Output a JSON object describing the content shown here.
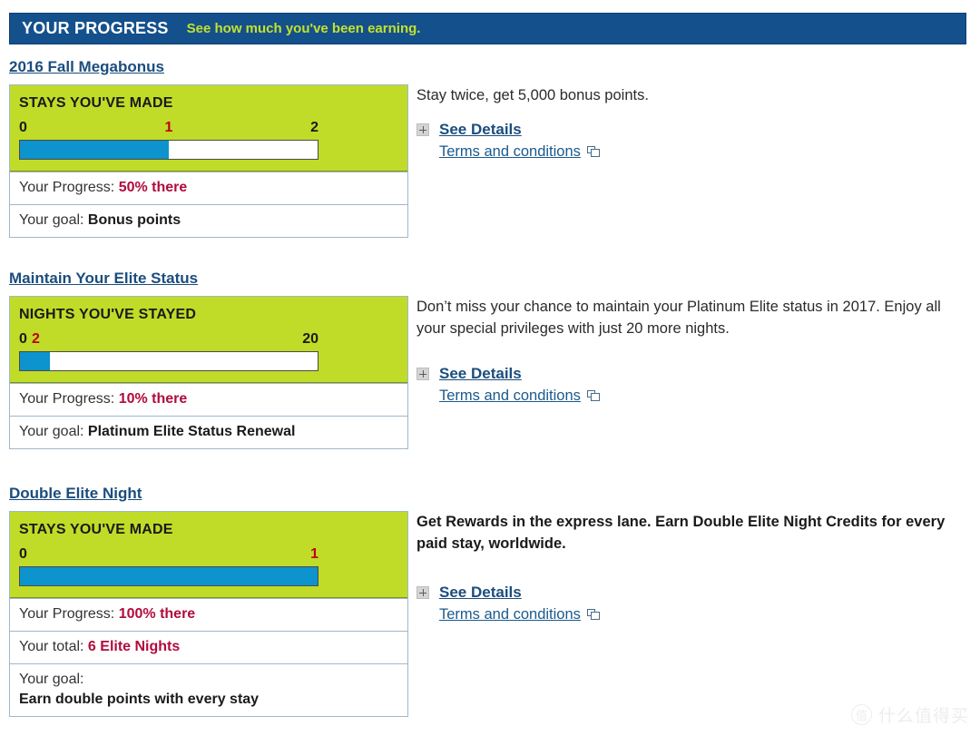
{
  "header": {
    "title": "YOUR PROGRESS",
    "subtitle": "See how much you've been earning.",
    "bg_color": "#14508c",
    "subtitle_color": "#c2e22d"
  },
  "colors": {
    "card_green": "#c0dc28",
    "bar_blue": "#0d93cd",
    "link_blue": "#1b4d7e",
    "value_red": "#b10b3d",
    "marker_red": "#c00010"
  },
  "sections": [
    {
      "link_label": "2016 Fall Megabonus",
      "card": {
        "heading": "STAYS YOU'VE MADE",
        "scale_min": "0",
        "scale_current": "1",
        "scale_max": "2",
        "percent": 50,
        "rows": [
          {
            "label": "Your Progress:",
            "value": "50% there",
            "style": "red",
            "stacked": false
          },
          {
            "label": "Your goal:",
            "value": "Bonus points",
            "style": "dark",
            "stacked": false
          }
        ]
      },
      "description": "Stay twice, get 5,000 bonus points.",
      "description_bold": false,
      "see_details_label": "See Details",
      "terms_label": "Terms and conditions"
    },
    {
      "link_label": "Maintain Your Elite Status",
      "card": {
        "heading": "NIGHTS YOU'VE STAYED",
        "scale_min": "0",
        "scale_current": "2",
        "scale_max": "20",
        "percent": 10,
        "rows": [
          {
            "label": "Your Progress:",
            "value": "10% there",
            "style": "red",
            "stacked": false
          },
          {
            "label": "Your goal:",
            "value": "Platinum Elite Status Renewal",
            "style": "dark",
            "stacked": false
          }
        ]
      },
      "description": "Don’t miss your chance to maintain your Platinum Elite status in 2017. Enjoy all your special privileges with just 20 more nights.",
      "description_bold": false,
      "see_details_label": "See Details",
      "terms_label": "Terms and conditions"
    },
    {
      "link_label": "Double Elite Night",
      "card": {
        "heading": "STAYS YOU'VE MADE",
        "scale_min": "0",
        "scale_current": "1",
        "scale_max": "",
        "percent": 100,
        "rows": [
          {
            "label": "Your Progress:",
            "value": "100% there",
            "style": "red",
            "stacked": false
          },
          {
            "label": "Your total:",
            "value": "6 Elite Nights",
            "style": "red",
            "stacked": false
          },
          {
            "label": "Your goal:",
            "value": "Earn double points with every stay",
            "style": "dark",
            "stacked": true
          }
        ]
      },
      "description": "Get Rewards in the express lane. Earn Double Elite Night Credits for every paid stay, worldwide.",
      "description_bold": true,
      "see_details_label": "See Details",
      "terms_label": "Terms and conditions"
    }
  ],
  "watermark": {
    "mark": "值",
    "text": "什么值得买"
  }
}
